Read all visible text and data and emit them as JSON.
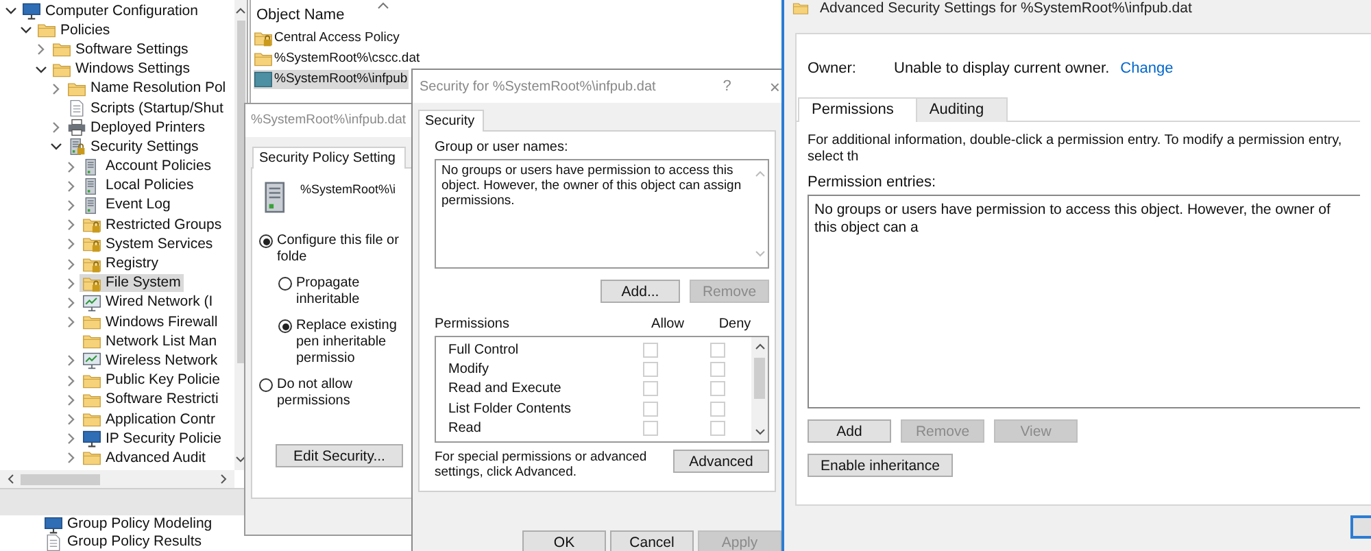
{
  "tree": {
    "items": [
      {
        "label": "Computer Configuration",
        "kind": "computer",
        "expandable": true,
        "expanded": true,
        "selected": false,
        "children": [
          {
            "label": "Policies",
            "kind": "folder",
            "expandable": true,
            "expanded": true,
            "selected": false,
            "children": [
              {
                "label": "Software Settings",
                "kind": "folder",
                "expandable": true,
                "expanded": false,
                "selected": false
              },
              {
                "label": "Windows Settings",
                "kind": "folder",
                "expandable": true,
                "expanded": true,
                "selected": false,
                "children": [
                  {
                    "label": "Name Resolution Pol",
                    "kind": "folder",
                    "expandable": true,
                    "expanded": false,
                    "selected": false
                  },
                  {
                    "label": "Scripts (Startup/Shut",
                    "kind": "document",
                    "expandable": false,
                    "selected": false
                  },
                  {
                    "label": "Deployed Printers",
                    "kind": "printer",
                    "expandable": true,
                    "expanded": false,
                    "selected": false
                  },
                  {
                    "label": "Security Settings",
                    "kind": "locked-server",
                    "expandable": true,
                    "expanded": true,
                    "selected": false,
                    "children": [
                      {
                        "label": "Account Policies",
                        "kind": "server",
                        "expandable": true,
                        "expanded": false,
                        "selected": false
                      },
                      {
                        "label": "Local Policies",
                        "kind": "server",
                        "expandable": true,
                        "expanded": false,
                        "selected": false
                      },
                      {
                        "label": "Event Log",
                        "kind": "server",
                        "expandable": true,
                        "expanded": false,
                        "selected": false
                      },
                      {
                        "label": "Restricted Groups",
                        "kind": "locked-folder",
                        "expandable": true,
                        "expanded": false,
                        "selected": false
                      },
                      {
                        "label": "System Services",
                        "kind": "locked-folder",
                        "expandable": true,
                        "expanded": false,
                        "selected": false
                      },
                      {
                        "label": "Registry",
                        "kind": "locked-folder",
                        "expandable": true,
                        "expanded": false,
                        "selected": false
                      },
                      {
                        "label": "File System",
                        "kind": "locked-folder",
                        "expandable": true,
                        "expanded": false,
                        "selected": true
                      },
                      {
                        "label": "Wired Network (I",
                        "kind": "monitor",
                        "expandable": true,
                        "expanded": false,
                        "selected": false
                      },
                      {
                        "label": "Windows Firewall",
                        "kind": "folder",
                        "expandable": true,
                        "expanded": false,
                        "selected": false
                      },
                      {
                        "label": "Network List Man",
                        "kind": "folder",
                        "expandable": false,
                        "selected": false
                      },
                      {
                        "label": "Wireless Network",
                        "kind": "monitor",
                        "expandable": true,
                        "expanded": false,
                        "selected": false
                      },
                      {
                        "label": "Public Key Policie",
                        "kind": "folder",
                        "expandable": true,
                        "expanded": false,
                        "selected": false
                      },
                      {
                        "label": "Software Restricti",
                        "kind": "folder",
                        "expandable": true,
                        "expanded": false,
                        "selected": false
                      },
                      {
                        "label": "Application Contr",
                        "kind": "folder",
                        "expandable": true,
                        "expanded": false,
                        "selected": false
                      },
                      {
                        "label": "IP Security Policie",
                        "kind": "computer",
                        "expandable": true,
                        "expanded": false,
                        "selected": false
                      },
                      {
                        "label": "Advanced Audit",
                        "kind": "folder",
                        "expandable": true,
                        "expanded": false,
                        "selected": false
                      }
                    ]
                  }
                ]
              }
            ]
          }
        ]
      }
    ]
  },
  "background_items": [
    {
      "label": "Group Policy Modeling",
      "kind": "computer"
    },
    {
      "label": "Group Policy Results",
      "kind": "document"
    }
  ],
  "object_list": {
    "header": "Object Name",
    "rows": [
      {
        "name": "Central Access Policy",
        "kind": "locked-folder",
        "selected": false
      },
      {
        "name": "%SystemRoot%\\cscc.dat",
        "kind": "folder",
        "selected": false
      },
      {
        "name": "%SystemRoot%\\infpub",
        "kind": "file",
        "selected": true
      }
    ]
  },
  "policy_window": {
    "title": "%SystemRoot%\\infpub.dat",
    "tab": "Security Policy Setting",
    "object": "%SystemRoot%\\i",
    "options": [
      {
        "label": "Configure this file or folde",
        "selected": true,
        "children": [
          {
            "label": "Propagate inheritable",
            "selected": false
          },
          {
            "label": "Replace existing pen inheritable permissio",
            "selected": true
          }
        ]
      },
      {
        "label": "Do not allow permissions",
        "selected": false
      }
    ],
    "button": "Edit Security..."
  },
  "security_dialog": {
    "title": "Security for %SystemRoot%\\infpub.dat",
    "help": "?",
    "close": "×",
    "tab": "Security",
    "group_label": "Group or user names:",
    "group_message": "No groups or users have permission to access this object. However, the owner of this object can assign permissions.",
    "group_buttons": [
      {
        "label": "Add...",
        "disabled": false
      },
      {
        "label": "Remove",
        "disabled": true
      }
    ],
    "permissions_label": "Permissions",
    "allow_label": "Allow",
    "deny_label": "Deny",
    "permissions": [
      {
        "name": "Full Control",
        "allow": false,
        "deny": false
      },
      {
        "name": "Modify",
        "allow": false,
        "deny": false
      },
      {
        "name": "Read and Execute",
        "allow": false,
        "deny": false
      },
      {
        "name": "List Folder Contents",
        "allow": false,
        "deny": false
      },
      {
        "name": "Read",
        "allow": false,
        "deny": false
      }
    ],
    "hint": "For special permissions or advanced settings, click Advanced.",
    "advanced_button": "Advanced",
    "footer_buttons": [
      {
        "label": "OK",
        "disabled": false
      },
      {
        "label": "Cancel",
        "disabled": false
      },
      {
        "label": "Apply",
        "disabled": true
      }
    ]
  },
  "advanced_window": {
    "title": "Advanced Security Settings for %SystemRoot%\\infpub.dat",
    "owner_label": "Owner:",
    "owner_value": "Unable to display current owner.",
    "change_link": "Change",
    "tabs": [
      {
        "label": "Permissions",
        "selected": true
      },
      {
        "label": "Auditing",
        "selected": false
      }
    ],
    "info": "For additional information, double-click a permission entry. To modify a permission entry, select th",
    "entries_label": "Permission entries:",
    "entries_message": "No groups or users have permission to access this object. However, the owner of this object can a",
    "buttons": [
      {
        "label": "Add",
        "disabled": false
      },
      {
        "label": "Remove",
        "disabled": true
      },
      {
        "label": "View",
        "disabled": true
      }
    ],
    "inheritance_button": "Enable inheritance"
  }
}
